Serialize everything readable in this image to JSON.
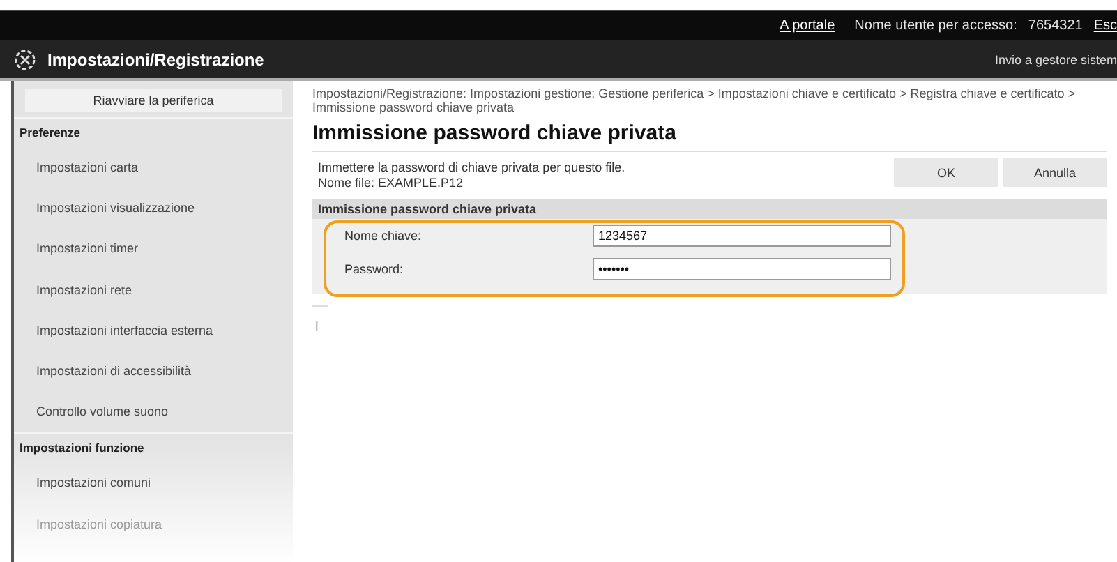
{
  "top_bar": {
    "portal_link": "A portale",
    "user_label": "Nome utente per accesso:",
    "user_id": "7654321",
    "logout_link": "Esc"
  },
  "header": {
    "title": "Impostazioni/Registrazione",
    "system_link": "Invio a gestore sistem"
  },
  "sidebar": {
    "restart_button": "Riavviare la periferica",
    "sections": [
      {
        "title": "Preferenze",
        "items": [
          "Impostazioni carta",
          "Impostazioni visualizzazione",
          "Impostazioni timer",
          "Impostazioni rete",
          "Impostazioni interfaccia esterna",
          "Impostazioni di accessibilità",
          "Controllo volume suono"
        ]
      },
      {
        "title": "Impostazioni funzione",
        "items": [
          "Impostazioni comuni",
          "Impostazioni copiatura"
        ]
      }
    ]
  },
  "breadcrumb": "Impostazioni/Registrazione: Impostazioni gestione: Gestione periferica > Impostazioni chiave e certificato > Registra chiave e certificato > Immissione password chiave privata",
  "page_title": "Immissione password chiave privata",
  "description": [
    "Immettere la password di chiave privata per questo file.",
    "Nome file: EXAMPLE.P12"
  ],
  "buttons": [
    "OK",
    "Annulla"
  ],
  "section": {
    "title": "Immissione password chiave privata",
    "fields": [
      {
        "label": "Nome chiave:",
        "value": "1234567"
      },
      {
        "label": "Password:",
        "value": "•••••••"
      }
    ]
  },
  "top_link": "⯒"
}
